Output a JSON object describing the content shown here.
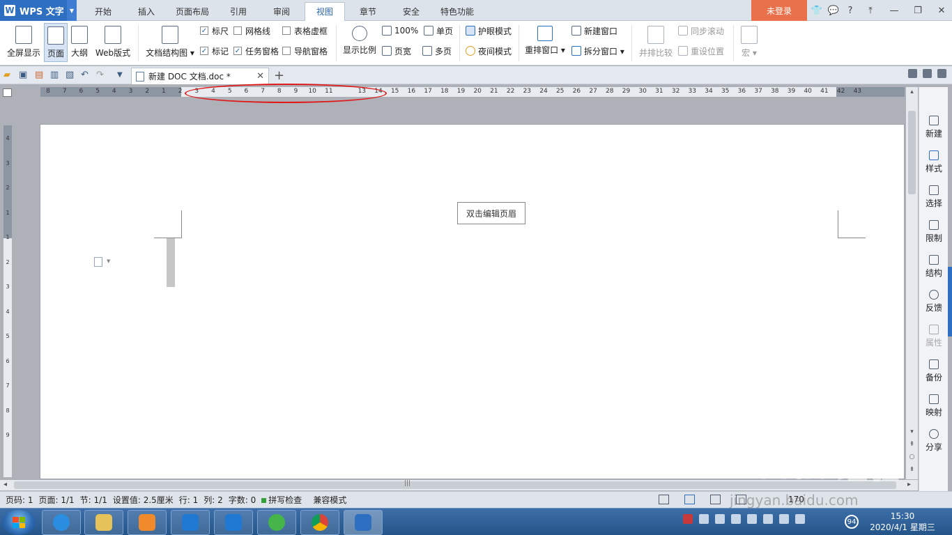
{
  "app": {
    "name": "WPS 文字",
    "logo": "W"
  },
  "menu_tabs": [
    "开始",
    "插入",
    "页面布局",
    "引用",
    "审阅",
    "视图",
    "章节",
    "安全",
    "特色功能"
  ],
  "active_tab": "视图",
  "login": "未登录",
  "title_icons": [
    "shirt-icon",
    "chat-icon",
    "help-icon",
    "upload-icon",
    "minimize-icon",
    "restore-icon",
    "close-icon"
  ],
  "title_glyphs": [
    "👕",
    "💬",
    "?",
    "⤒",
    "—",
    "❐",
    "✕"
  ],
  "ribbon": {
    "fullscreen": "全屏显示",
    "page": "页面",
    "outline": "大纲",
    "web": "Web版式",
    "doc_map": "文档结构图",
    "ruler": "标尺",
    "gridlines": "网格线",
    "table_grid": "表格虚框",
    "marks": "标记",
    "task_pane": "任务窗格",
    "nav_pane": "导航窗格",
    "zoom": "显示比例",
    "zoom_100": "100%",
    "page_width": "页宽",
    "single_page": "单页",
    "multi_page": "多页",
    "eye_mode": "护眼模式",
    "night_mode": "夜间模式",
    "arrange": "重排窗口",
    "new_window": "新建窗口",
    "split": "拆分窗口",
    "side_by_side": "并排比较",
    "sync_scroll": "同步滚动",
    "reset_pos": "重设位置",
    "macro": "宏"
  },
  "checks": {
    "ruler": true,
    "gridlines": false,
    "table_grid": false,
    "marks": true,
    "task_pane": true,
    "nav_pane": false
  },
  "document_tab": {
    "title": "新建 DOC 文档.doc *"
  },
  "hruler_numbers": [
    "8",
    "7",
    "6",
    "5",
    "4",
    "3",
    "2",
    "1",
    "2",
    "3",
    "4",
    "5",
    "6",
    "7",
    "8",
    "9",
    "10",
    "11",
    "13",
    "14",
    "15",
    "16",
    "17",
    "18",
    "19",
    "20",
    "21",
    "22",
    "23",
    "24",
    "25",
    "26",
    "27",
    "28",
    "29",
    "30",
    "31",
    "32",
    "33",
    "34",
    "35",
    "36",
    "37",
    "38",
    "39",
    "40",
    "41",
    "42",
    "43"
  ],
  "vruler_numbers": [
    "4",
    "3",
    "2",
    "1",
    "1",
    "2",
    "3",
    "4",
    "5",
    "6",
    "7",
    "8",
    "9"
  ],
  "page": {
    "header_hint": "双击编辑页眉"
  },
  "sidebar": [
    {
      "label": "新建",
      "icon": "new-doc-icon",
      "disabled": false
    },
    {
      "label": "样式",
      "icon": "style-icon",
      "disabled": false
    },
    {
      "label": "选择",
      "icon": "select-icon",
      "disabled": false
    },
    {
      "label": "限制",
      "icon": "restrict-icon",
      "disabled": false
    },
    {
      "label": "结构",
      "icon": "structure-icon",
      "disabled": false
    },
    {
      "label": "反馈",
      "icon": "feedback-icon",
      "disabled": false
    },
    {
      "label": "属性",
      "icon": "properties-icon",
      "disabled": true
    },
    {
      "label": "备份",
      "icon": "backup-icon",
      "disabled": false
    },
    {
      "label": "映射",
      "icon": "mapping-icon",
      "disabled": false
    },
    {
      "label": "分享",
      "icon": "share-icon",
      "disabled": false
    }
  ],
  "status": {
    "page_num": "页码: 1",
    "pages": "页面: 1/1",
    "section": "节: 1/1",
    "setting": "设置值: 2.5厘米",
    "row": "行: 1",
    "col": "列: 2",
    "words": "字数: 0",
    "spell": "拼写检查",
    "compat": "兼容模式",
    "zoom": "170"
  },
  "taskbar": {
    "time": "15:30",
    "date": "2020/4/1 星期三",
    "badge": "94"
  },
  "watermark": {
    "brand": "Baidu经验",
    "url": "jingyan.baidu.com"
  },
  "colors": {
    "accent": "#2f6fc2",
    "login": "#e8704a",
    "annotation": "#e01818"
  }
}
